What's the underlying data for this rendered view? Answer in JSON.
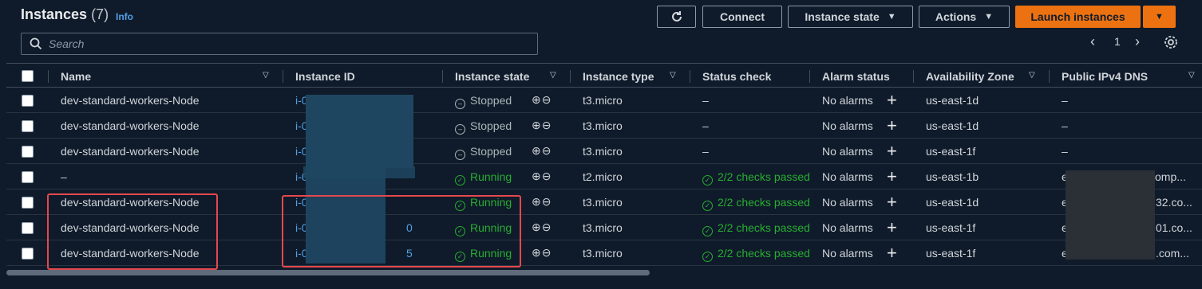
{
  "header": {
    "title": "Instances",
    "count": "(7)",
    "info": "Info",
    "refresh_icon": "refresh-icon",
    "connect": "Connect",
    "instance_state": "Instance state",
    "actions": "Actions",
    "launch": "Launch instances"
  },
  "search": {
    "placeholder": "Search"
  },
  "pagination": {
    "page": "1"
  },
  "columns": [
    "Name",
    "Instance ID",
    "Instance state",
    "Instance type",
    "Status check",
    "Alarm status",
    "Availability Zone",
    "Public IPv4 DNS"
  ],
  "rows": [
    {
      "name": "dev-standard-workers-Node",
      "id": "i-0",
      "state": "Stopped",
      "type": "t3.micro",
      "status": "–",
      "alarm": "No alarms",
      "az": "us-east-1d",
      "dns": "–"
    },
    {
      "name": "dev-standard-workers-Node",
      "id": "i-0",
      "state": "Stopped",
      "type": "t3.micro",
      "status": "–",
      "alarm": "No alarms",
      "az": "us-east-1d",
      "dns": "–"
    },
    {
      "name": "dev-standard-workers-Node",
      "id": "i-0",
      "state": "Stopped",
      "type": "t3.micro",
      "status": "–",
      "alarm": "No alarms",
      "az": "us-east-1f",
      "dns": "–"
    },
    {
      "name": "–",
      "id": "i-0",
      "state": "Running",
      "type": "t2.micro",
      "status": "2/2 checks passed",
      "alarm": "No alarms",
      "az": "us-east-1b",
      "dns": "e",
      "dns_tail": "comp..."
    },
    {
      "name": "dev-standard-workers-Node",
      "id": "i-0",
      "state": "Running",
      "type": "t3.micro",
      "status": "2/2 checks passed",
      "alarm": "No alarms",
      "az": "us-east-1d",
      "dns": "e",
      "dns_tail": "32.co..."
    },
    {
      "name": "dev-standard-workers-Node",
      "id": "i-0",
      "id_tail": "0",
      "state": "Running",
      "type": "t3.micro",
      "status": "2/2 checks passed",
      "alarm": "No alarms",
      "az": "us-east-1f",
      "dns": "e",
      "dns_tail": "01.co..."
    },
    {
      "name": "dev-standard-workers-Node",
      "id": "i-0",
      "id_tail": "5",
      "state": "Running",
      "type": "t3.micro",
      "status": "2/2 checks passed",
      "alarm": "No alarms",
      "az": "us-east-1f",
      "dns": "e",
      "dns_tail": ".com..."
    }
  ],
  "colors": {
    "accent": "#ec7211",
    "link": "#539fe5",
    "success": "#29ad32",
    "highlight": "#e5484d"
  }
}
